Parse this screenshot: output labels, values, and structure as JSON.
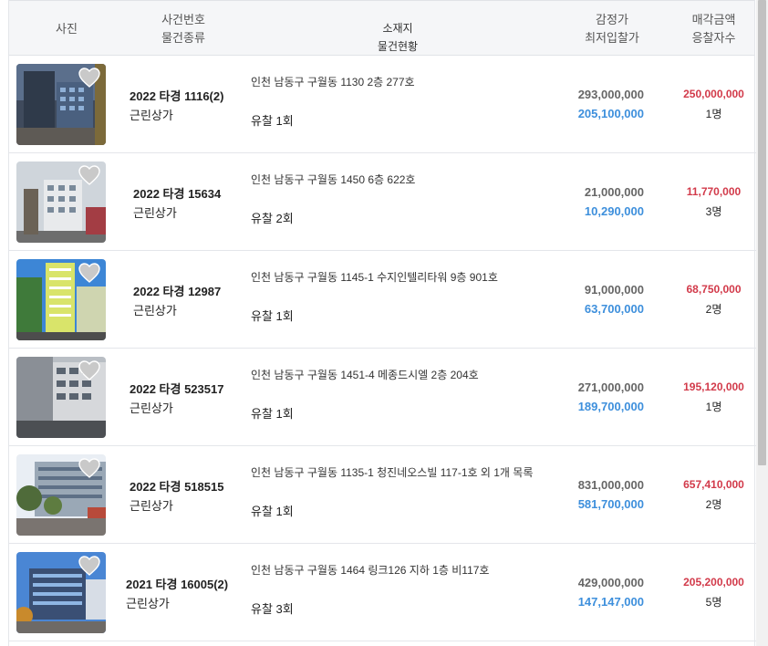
{
  "header": {
    "photo": "사진",
    "case_line1": "사건번호",
    "case_line2": "물건종류",
    "addr_line1": "소재지",
    "addr_line2": "물건현황",
    "price_line1": "감정가",
    "price_line2": "최저입찰가",
    "sale_line1": "매각금액",
    "sale_line2": "응찰자수"
  },
  "colors": {
    "appraisal": "#666666",
    "min_bid": "#3d8fdc",
    "sale_price": "#d23a4a"
  },
  "rows": [
    {
      "case_no": "2022 타경 1116(2)",
      "type": "근린상가",
      "address": "인천 남동구 구월동 1130 2층 277호",
      "status": "유찰 1회",
      "appraisal": "293,000,000",
      "min_bid": "205,100,000",
      "sale_price": "250,000,000",
      "bidders": "1명"
    },
    {
      "case_no": "2022 타경 15634",
      "type": "근린상가",
      "address": "인천 남동구 구월동 1450 6층 622호",
      "status": "유찰 2회",
      "appraisal": "21,000,000",
      "min_bid": "10,290,000",
      "sale_price": "11,770,000",
      "bidders": "3명"
    },
    {
      "case_no": "2022 타경 12987",
      "type": "근린상가",
      "address": "인천 남동구 구월동 1145-1 수지인텔리타워 9층 901호",
      "status": "유찰 1회",
      "appraisal": "91,000,000",
      "min_bid": "63,700,000",
      "sale_price": "68,750,000",
      "bidders": "2명"
    },
    {
      "case_no": "2022 타경 523517",
      "type": "근린상가",
      "address": "인천 남동구 구월동 1451-4 메종드시엘 2층 204호",
      "status": "유찰 1회",
      "appraisal": "271,000,000",
      "min_bid": "189,700,000",
      "sale_price": "195,120,000",
      "bidders": "1명"
    },
    {
      "case_no": "2022 타경 518515",
      "type": "근린상가",
      "address": "인천 남동구 구월동 1135-1 청진네오스빌 117-1호 외 1개 목록",
      "status": "유찰 1회",
      "appraisal": "831,000,000",
      "min_bid": "581,700,000",
      "sale_price": "657,410,000",
      "bidders": "2명"
    },
    {
      "case_no": "2021 타경 16005(2)",
      "type": "근린상가",
      "address": "인천 남동구 구월동 1464 링크126 지하 1층 비117호",
      "status": "유찰 3회",
      "appraisal": "429,000,000",
      "min_bid": "147,147,000",
      "sale_price": "205,200,000",
      "bidders": "5명"
    }
  ]
}
